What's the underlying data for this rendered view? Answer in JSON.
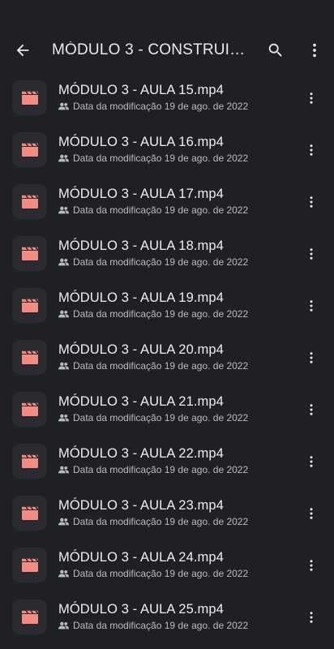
{
  "appbar": {
    "title": "MÓDULO 3 - CONSTRUINDO...",
    "back_icon": "arrow-back-icon",
    "search_icon": "search-icon",
    "more_icon": "more-vert-icon"
  },
  "colors": {
    "background": "#1f2024",
    "thumb_bg": "#2a2b30",
    "video_icon": "#f28b82",
    "primary_text": "#eceef1",
    "secondary_text": "#b9bcc2"
  },
  "files": [
    {
      "name": "MÓDULO 3 - AULA 15.mp4",
      "meta": "Data da modificação 19 de ago. de 2022"
    },
    {
      "name": "MÓDULO 3 - AULA 16.mp4",
      "meta": "Data da modificação 19 de ago. de 2022"
    },
    {
      "name": "MÓDULO 3 - AULA 17.mp4",
      "meta": "Data da modificação 19 de ago. de 2022"
    },
    {
      "name": "MÓDULO 3 - AULA 18.mp4",
      "meta": "Data da modificação 19 de ago. de 2022"
    },
    {
      "name": "MÓDULO 3 - AULA 19.mp4",
      "meta": "Data da modificação 19 de ago. de 2022"
    },
    {
      "name": "MÓDULO 3 - AULA 20.mp4",
      "meta": "Data da modificação 19 de ago. de 2022"
    },
    {
      "name": "MÓDULO 3 - AULA 21.mp4",
      "meta": "Data da modificação 19 de ago. de 2022"
    },
    {
      "name": "MÓDULO 3 - AULA 22.mp4",
      "meta": "Data da modificação 19 de ago. de 2022"
    },
    {
      "name": "MÓDULO 3 - AULA 23.mp4",
      "meta": "Data da modificação 19 de ago. de 2022"
    },
    {
      "name": "MÓDULO 3 - AULA 24.mp4",
      "meta": "Data da modificação 19 de ago. de 2022"
    },
    {
      "name": "MÓDULO 3 - AULA 25.mp4",
      "meta": "Data da modificação 19 de ago. de 2022"
    }
  ]
}
